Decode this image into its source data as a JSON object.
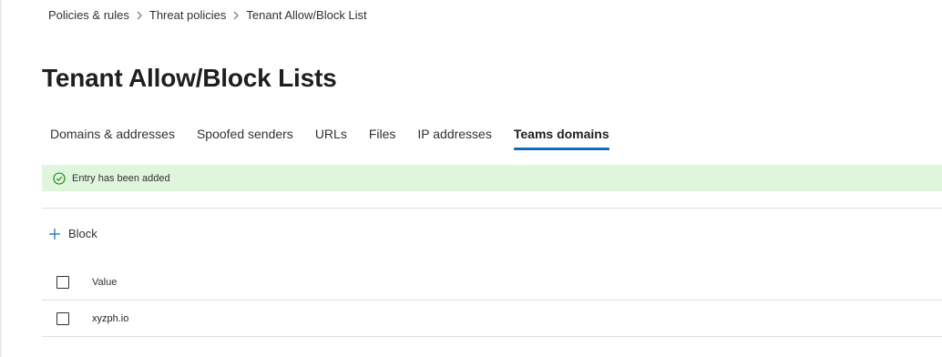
{
  "breadcrumb": {
    "items": [
      "Policies & rules",
      "Threat policies",
      "Tenant Allow/Block List"
    ]
  },
  "page": {
    "title": "Tenant Allow/Block Lists"
  },
  "tabs": [
    {
      "label": "Domains & addresses",
      "active": false
    },
    {
      "label": "Spoofed senders",
      "active": false
    },
    {
      "label": "URLs",
      "active": false
    },
    {
      "label": "Files",
      "active": false
    },
    {
      "label": "IP addresses",
      "active": false
    },
    {
      "label": "Teams domains",
      "active": true
    }
  ],
  "message_bar": {
    "text": "Entry has been added",
    "icon": "success-check-icon",
    "color": "#dff6dd"
  },
  "toolbar": {
    "block_label": "Block",
    "icon": "add-icon"
  },
  "table": {
    "columns": [
      "Value"
    ],
    "rows": [
      {
        "value": "xyzph.io"
      }
    ]
  },
  "colors": {
    "accent": "#0f6cbd",
    "success_bg": "#dff6dd",
    "success_icon": "#107c10"
  }
}
